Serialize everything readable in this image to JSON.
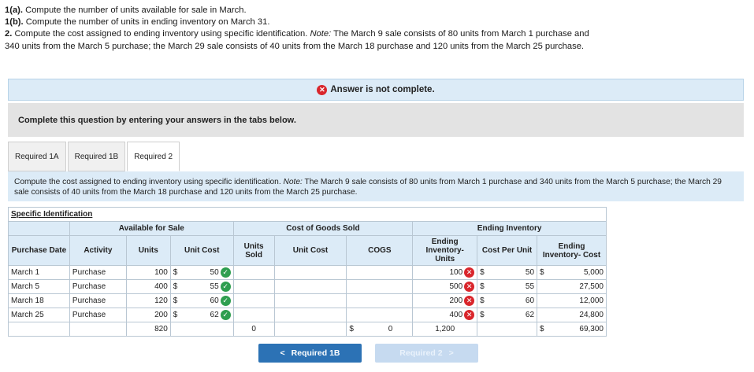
{
  "instructions": {
    "line1_bold": "1(a).",
    "line1_text": " Compute the number of units available for sale in March.",
    "line2_bold": "1(b).",
    "line2_text": " Compute the number of units in ending inventory on March 31.",
    "line3_bold": "2.",
    "line3_text": " Compute the cost assigned to ending inventory using specific identification. ",
    "line3_note_label": "Note:",
    "line3_note_text": " The March 9 sale consists of 80 units from March 1 purchase and 340 units from the March 5 purchase; the March 29 sale consists of 40 units from the March 18 purchase and 120 units from the March 25 purchase."
  },
  "banner": {
    "text": "Answer is not complete."
  },
  "complete_box": {
    "text": "Complete this question by entering your answers in the tabs below."
  },
  "tabs": [
    {
      "label": "Required 1A"
    },
    {
      "label": "Required 1B"
    },
    {
      "label": "Required 2"
    }
  ],
  "content": {
    "text": "Compute the cost assigned to ending inventory using specific identification. ",
    "note_label": "Note:",
    "note_text": " The March 9 sale consists of 80 units from March 1 purchase and 340 units from the March 5 purchase; the March 29 sale consists of 40 units from the March 18 purchase and 120 units from the March 25 purchase."
  },
  "sheet": {
    "title": "Specific Identification",
    "groups": {
      "available": "Available for Sale",
      "cogs": "Cost of Goods Sold",
      "ending": "Ending Inventory"
    },
    "headers": {
      "date": "Purchase Date",
      "activity": "Activity",
      "units": "Units",
      "unit_cost": "Unit Cost",
      "units_sold": "Units Sold",
      "cogs_unit_cost": "Unit Cost",
      "cogs": "COGS",
      "end_units": "Ending Inventory- Units",
      "cost_per_unit": "Cost Per Unit",
      "end_cost": "Ending Inventory- Cost"
    },
    "rows": [
      {
        "date": "March 1",
        "activity": "Purchase",
        "units": "100",
        "dollar": "$",
        "unit_cost": "50",
        "end_units": "100",
        "dollar2": "$",
        "cost_per_unit": "50",
        "dollar3": "$",
        "end_cost": "5,000"
      },
      {
        "date": "March 5",
        "activity": "Purchase",
        "units": "400",
        "dollar": "$",
        "unit_cost": "55",
        "end_units": "500",
        "dollar2": "$",
        "cost_per_unit": "55",
        "dollar3": "",
        "end_cost": "27,500"
      },
      {
        "date": "March 18",
        "activity": "Purchase",
        "units": "120",
        "dollar": "$",
        "unit_cost": "60",
        "end_units": "200",
        "dollar2": "$",
        "cost_per_unit": "60",
        "dollar3": "",
        "end_cost": "12,000"
      },
      {
        "date": "March 25",
        "activity": "Purchase",
        "units": "200",
        "dollar": "$",
        "unit_cost": "62",
        "end_units": "400",
        "dollar2": "$",
        "cost_per_unit": "62",
        "dollar3": "",
        "end_cost": "24,800"
      }
    ],
    "totals": {
      "units": "820",
      "units_sold": "0",
      "dollar_cogs": "$",
      "cogs": "0",
      "end_units": "1,200",
      "dollar3": "$",
      "end_cost": "69,300"
    }
  },
  "nav": {
    "prev_label": "Required 1B",
    "next_label": "Required 2"
  }
}
